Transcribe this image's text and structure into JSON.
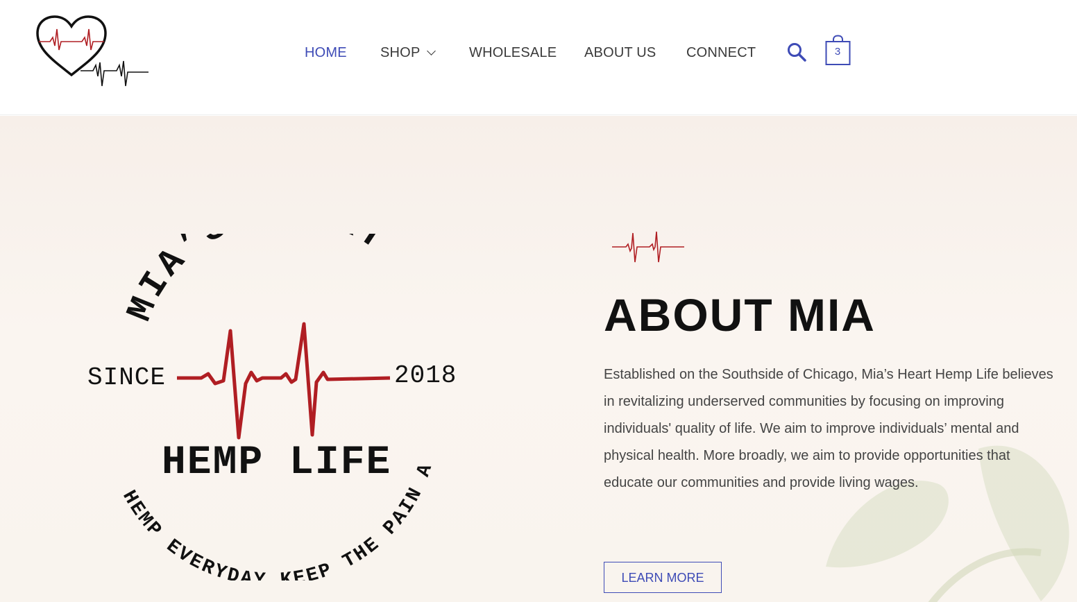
{
  "header": {
    "nav": [
      {
        "label": "HOME",
        "active": true
      },
      {
        "label": "SHOP",
        "active": false
      },
      {
        "label": "WHOLESALE",
        "active": false
      },
      {
        "label": "ABOUT US",
        "active": false
      },
      {
        "label": "CONNECT",
        "active": false
      }
    ],
    "cart_count": "3",
    "icons": [
      "heart-pulse-logo-icon",
      "search-icon",
      "shopping-bag-icon",
      "chevron-down-icon"
    ]
  },
  "hero": {
    "emblem": {
      "top_arc": "MIA’S HEART",
      "since": "SINCE",
      "year": "2018",
      "name": "HEMP LIFE",
      "bottom_arc": "HEMP EVERYDAY KEEP THE PAIN AWAY"
    },
    "title": "ABOUT MIA",
    "description": "Established on the Southside of Chicago, Mia’s Heart Hemp Life believes in revitalizing underserved communities by focusing on improving individuals' quality of life. We aim to improve individuals’ mental and physical health. More broadly, we aim to provide opportunities that educate our communities and provide living wages.",
    "button_label": "LEARN MORE"
  },
  "colors": {
    "accent": "#3e4bb6",
    "pulse_red": "#b01e23",
    "text_dark": "#111111",
    "body_text": "#444444",
    "hero_bg": "#f8f2ec"
  }
}
